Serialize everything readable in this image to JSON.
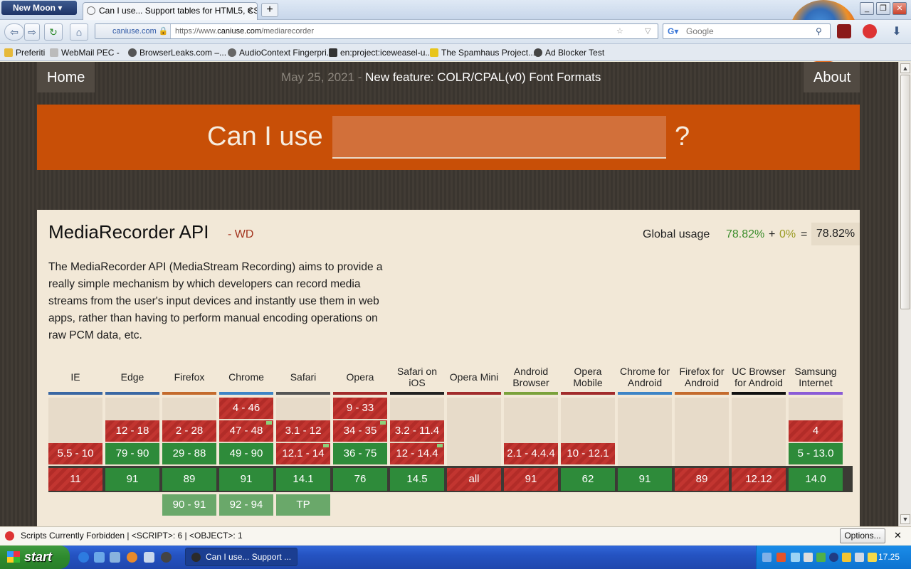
{
  "browser": {
    "app_menu": "New Moon",
    "tab_title": "Can I use... Support tables for HTML5, CS...",
    "tab_close": "×",
    "new_tab": "+",
    "site_identity": "caniuse.com",
    "url_prefix": "https://www.",
    "url_host": "caniuse.com",
    "url_path": "/mediarecorder",
    "search_placeholder": "Google",
    "window_buttons": [
      "_",
      "❐",
      "✕"
    ]
  },
  "bookmarks": [
    "Preferiti",
    "WebMail PEC -",
    "BrowserLeaks.com –...",
    "AudioContext Fingerpri...",
    "en:project:iceweasel-u...",
    "The Spamhaus Project...",
    "Ad Blocker Test"
  ],
  "site": {
    "nav_home": "Home",
    "nav_about": "About",
    "news_date": "May 25, 2021",
    "news_sep": " - ",
    "news_text": "New feature: COLR/CPAL(v0) Font Formats",
    "hero_label": "Can I use",
    "hero_q": "?",
    "search_value": ""
  },
  "feature": {
    "title": "MediaRecorder API",
    "status": "- WD",
    "usage_label": "Global usage",
    "usage_supported": "78.82%",
    "usage_plus": "+",
    "usage_partial": "0%",
    "usage_eq": "=",
    "usage_total": "78.82%",
    "description": "The MediaRecorder API (MediaStream Recording) aims to provide a really simple mechanism by which developers can record media streams from the user's input devices and instantly use them in web apps, rather than having to perform manual encoding operations on raw PCM data, etc."
  },
  "browsers": [
    {
      "name": "IE",
      "color": "#3a67a3",
      "rows": {
        "r3": {
          "v": "5.5 - 10",
          "s": "n"
        },
        "cur": {
          "v": "11",
          "s": "n"
        }
      }
    },
    {
      "name": "Edge",
      "color": "#3a67a3",
      "rows": {
        "r2": {
          "v": "12 - 18",
          "s": "n"
        },
        "r3": {
          "v": "79 - 90",
          "s": "y"
        },
        "cur": {
          "v": "91",
          "s": "y"
        }
      }
    },
    {
      "name": "Firefox",
      "color": "#c46a2c",
      "rows": {
        "r2": {
          "v": "2 - 28",
          "s": "n"
        },
        "r3": {
          "v": "29 - 88",
          "s": "y"
        },
        "cur": {
          "v": "89",
          "s": "y"
        },
        "f1": {
          "v": "90 - 91",
          "s": "f"
        }
      }
    },
    {
      "name": "Chrome",
      "color": "#3d84c6",
      "rows": {
        "r1": {
          "v": "4 - 46",
          "s": "n"
        },
        "r2": {
          "v": "47 - 48",
          "s": "n",
          "flag": true
        },
        "r3": {
          "v": "49 - 90",
          "s": "y"
        },
        "cur": {
          "v": "91",
          "s": "y"
        },
        "f1": {
          "v": "92 - 94",
          "s": "f"
        }
      }
    },
    {
      "name": "Safari",
      "color": "#555555",
      "rows": {
        "r2": {
          "v": "3.1 - 12",
          "s": "n"
        },
        "r3": {
          "v": "12.1 - 14",
          "s": "n",
          "flag": true
        },
        "cur": {
          "v": "14.1",
          "s": "y"
        },
        "f1": {
          "v": "TP",
          "s": "f"
        }
      }
    },
    {
      "name": "Opera",
      "color": "#a12b2b",
      "rows": {
        "r1": {
          "v": "9 - 33",
          "s": "n"
        },
        "r2": {
          "v": "34 - 35",
          "s": "n",
          "flag": true
        },
        "r3": {
          "v": "36 - 75",
          "s": "y"
        },
        "cur": {
          "v": "76",
          "s": "y"
        }
      }
    },
    {
      "name": "Safari on iOS",
      "color": "#222222",
      "rows": {
        "r2": {
          "v": "3.2 - 11.4",
          "s": "n"
        },
        "r3": {
          "v": "12 - 14.4",
          "s": "n",
          "flag": true
        },
        "cur": {
          "v": "14.5",
          "s": "y"
        }
      }
    },
    {
      "name": "Opera Mini",
      "color": "#a12b2b",
      "rows": {
        "cur": {
          "v": "all",
          "s": "n"
        }
      }
    },
    {
      "name": "Android Browser",
      "color": "#7aa13a",
      "rows": {
        "r3": {
          "v": "2.1 - 4.4.4",
          "s": "n"
        },
        "cur": {
          "v": "91",
          "s": "n"
        }
      }
    },
    {
      "name": "Opera Mobile",
      "color": "#a12b2b",
      "rows": {
        "r3": {
          "v": "10 - 12.1",
          "s": "n"
        },
        "cur": {
          "v": "62",
          "s": "y"
        }
      }
    },
    {
      "name": "Chrome for Android",
      "color": "#3d84c6",
      "rows": {
        "cur": {
          "v": "91",
          "s": "y"
        }
      }
    },
    {
      "name": "Firefox for Android",
      "color": "#c46a2c",
      "rows": {
        "cur": {
          "v": "89",
          "s": "n"
        }
      }
    },
    {
      "name": "UC Browser for Android",
      "color": "#111111",
      "rows": {
        "cur": {
          "v": "12.12",
          "s": "n"
        }
      }
    },
    {
      "name": "Samsung Internet",
      "color": "#8a5bd6",
      "rows": {
        "r2": {
          "v": "4",
          "s": "n"
        },
        "r3": {
          "v": "5 - 13.0",
          "s": "y"
        },
        "cur": {
          "v": "14.0",
          "s": "y"
        }
      }
    }
  ],
  "statusbar": {
    "text": "Scripts Currently Forbidden | <SCRIPT>: 6 | <OBJECT>: 1",
    "options": "Options...",
    "close": "✕"
  },
  "taskbar": {
    "start": "start",
    "task_item": "Can I use... Support ...",
    "clock": "17.25"
  }
}
